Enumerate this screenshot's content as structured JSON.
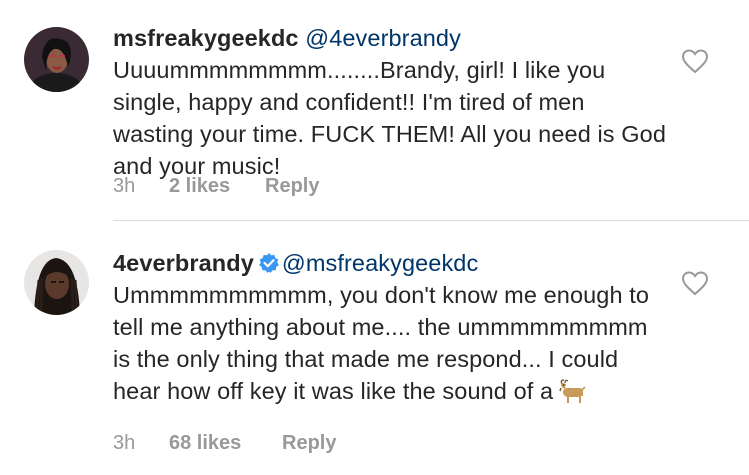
{
  "comments": [
    {
      "username": "msfreakygeekdc",
      "mention": "@4everbrandy",
      "text": "Uuuummmmmmmm........Brandy, girl! I like you single, happy and confident!! I'm tired of men wasting your time. FUCK THEM! All you need is God and your music!",
      "time": "3h",
      "likes": "2 likes",
      "reply": "Reply",
      "verified": false
    },
    {
      "username": "4everbrandy",
      "mention": "@msfreakygeekdc",
      "text": "Ummmmmmmmmm, you don't know me enough to tell me anything about me.... the ummmmmmmmm is the only thing that made me respond... I could hear how off key it was like the sound of a",
      "emoji": "goat-emoji",
      "time": "3h",
      "likes": "68 likes",
      "reply": "Reply",
      "verified": true
    }
  ],
  "colors": {
    "text": "#262626",
    "mention": "#003569",
    "meta": "#999999",
    "verified": "#3897f0",
    "divider": "#dbdbdb"
  }
}
